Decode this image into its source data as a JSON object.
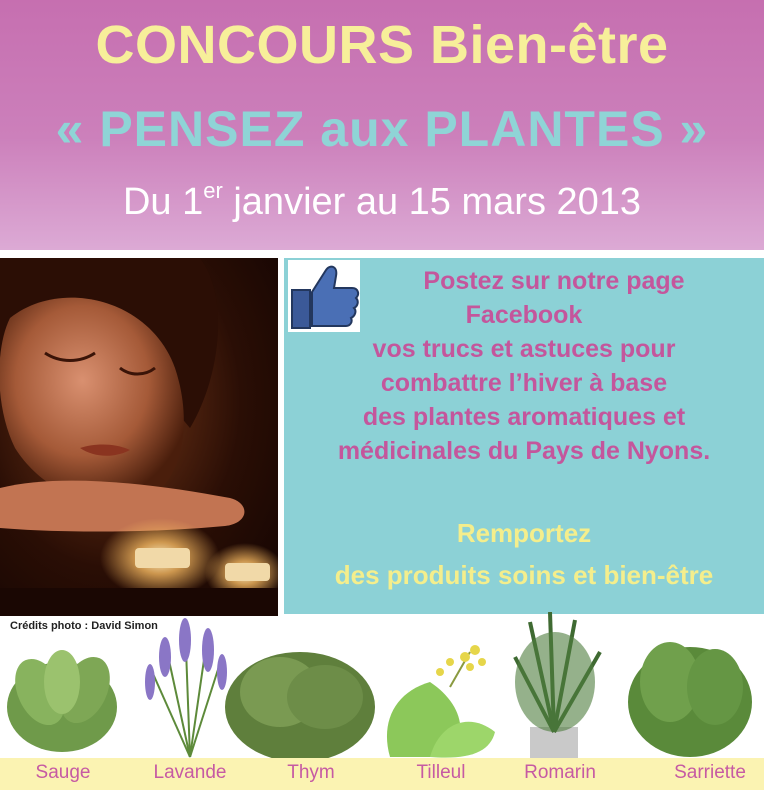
{
  "header": {
    "title_line1": "CONCOURS Bien-être",
    "title_line2": "« PENSEZ aux PLANTES »",
    "date_prefix": "Du 1",
    "date_sup": "er",
    "date_suffix": " janvier au 15 mars 2013"
  },
  "photo": {
    "credits": "Crédits photo : David Simon"
  },
  "panel": {
    "line1": "Postez sur notre page",
    "line2": "Facebook",
    "rest": [
      "vos trucs et astuces pour",
      "combattre l’hiver à base",
      "des plantes aromatiques et",
      "médicinales du Pays de Nyons."
    ],
    "win_line1": "Remportez",
    "win_line2": "des produits soins et bien-être"
  },
  "plants": [
    "Sauge",
    "Lavande",
    "Thym",
    "Tilleul",
    "Romarin",
    "Sarriette"
  ],
  "colors": {
    "header_pink": "#c66fb0",
    "yellow": "#f7ef9a",
    "teal": "#8fd4d6",
    "panel_teal": "#8cd1d6",
    "magenta_text": "#c4569c",
    "label_bar": "#fbf3b2"
  }
}
